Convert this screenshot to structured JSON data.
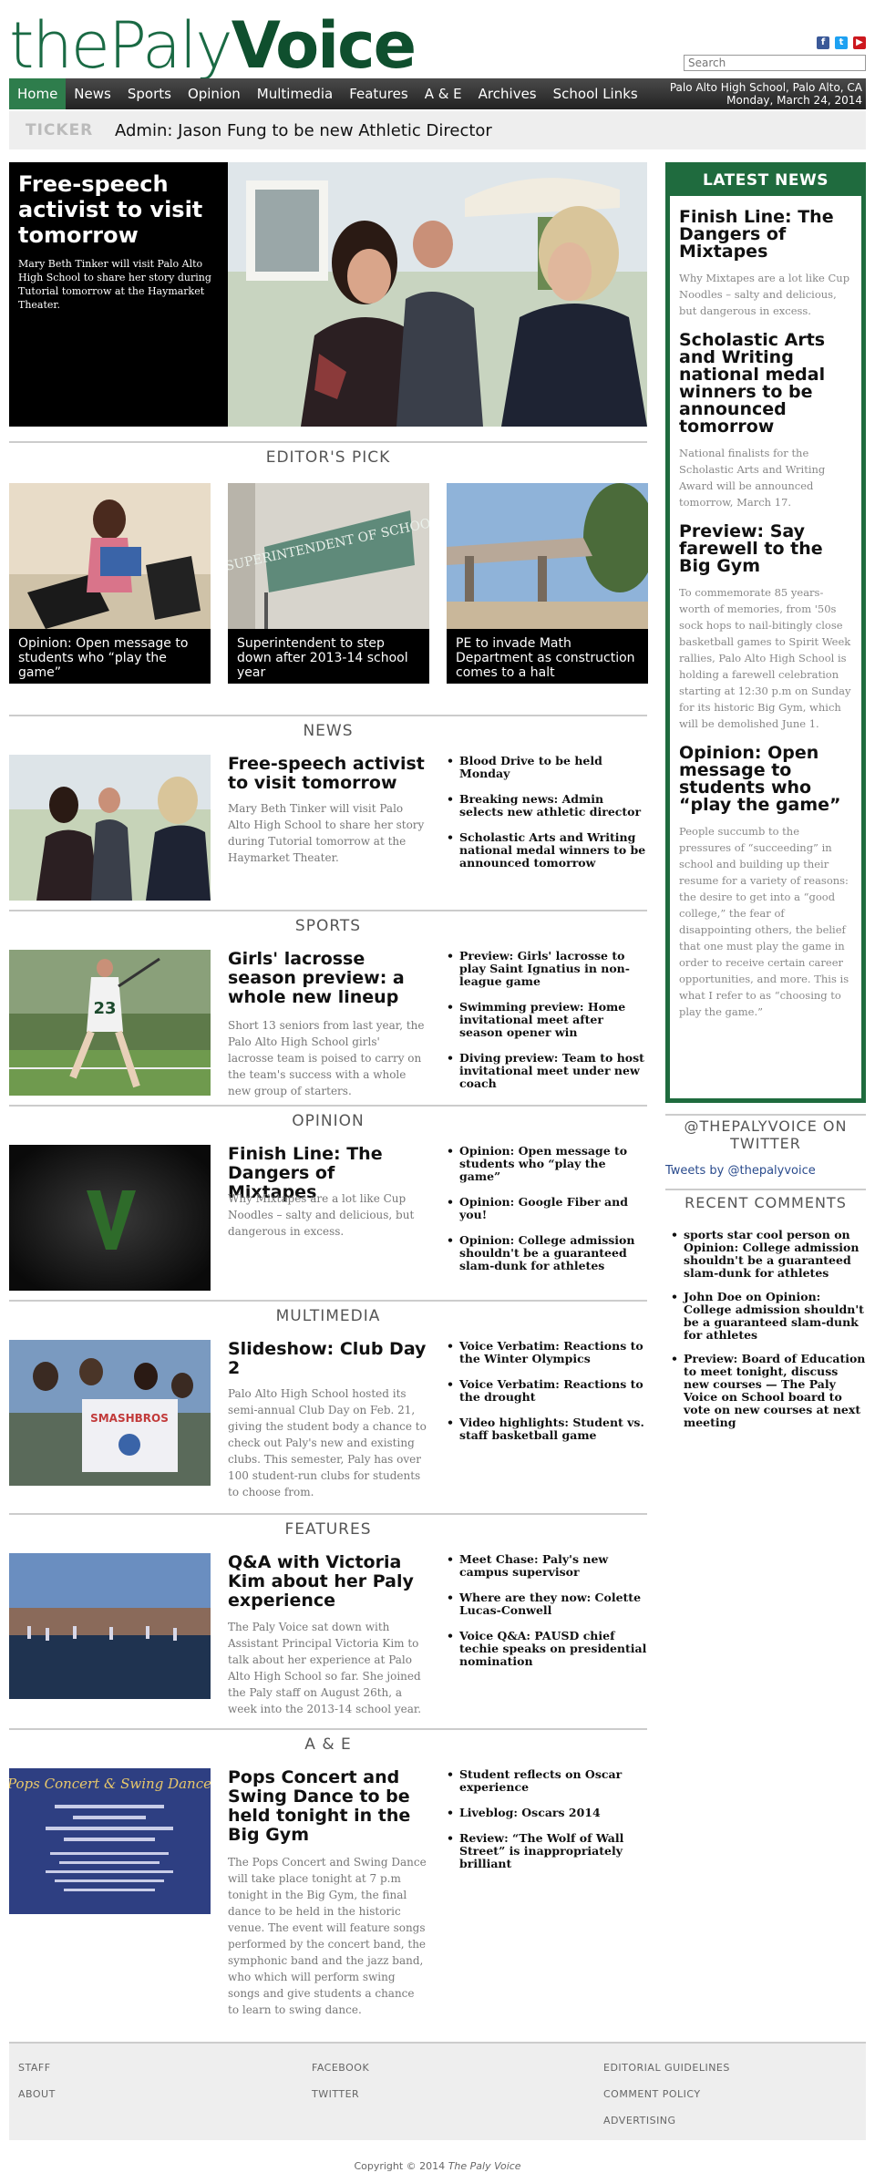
{
  "site": {
    "logo_light": "thePaly",
    "logo_bold": "Voice",
    "search_placeholder": "Search"
  },
  "social": [
    {
      "icon": "facebook-icon",
      "glyph": "f",
      "color": "#3b5998"
    },
    {
      "icon": "twitter-icon",
      "glyph": "t",
      "color": "#1da1f2"
    },
    {
      "icon": "youtube-icon",
      "glyph": "▶",
      "color": "#cc181e"
    }
  ],
  "nav": {
    "items": [
      "Home",
      "News",
      "Sports",
      "Opinion",
      "Multimedia",
      "Features",
      "A & E",
      "Archives",
      "School Links"
    ],
    "location": "Palo Alto High School, Palo Alto, CA",
    "date": "Monday, March 24, 2014"
  },
  "ticker": {
    "label": "TICKER",
    "text": "Admin: Jason Fung to be new Athletic Director"
  },
  "hero": {
    "title": "Free-speech activist to visit tomorrow",
    "summary": "Mary Beth Tinker will visit Palo Alto High School to share her story during Tutorial tomorrow at the Haymarket Theater."
  },
  "editors_pick": {
    "heading": "EDITOR'S PICK",
    "items": [
      {
        "caption": "Opinion: Open message to students who “play the game”"
      },
      {
        "caption": "Superintendent to step down after 2013-14 school year",
        "sign": "SUPERINTENDENT OF SCHOOLS"
      },
      {
        "caption": "PE to invade Math Department as construction comes to a halt"
      }
    ]
  },
  "sections": {
    "news": {
      "heading": "NEWS",
      "title": "Free-speech activist to visit tomorrow",
      "summary": "Mary Beth Tinker will visit Palo Alto High School to share her story during Tutorial tomorrow at the Haymarket Theater.",
      "links": [
        "Blood Drive to be held Monday",
        "Breaking news: Admin selects new athletic director",
        "Scholastic Arts and Writing national medal winners to be announced tomorrow"
      ]
    },
    "sports": {
      "heading": "SPORTS",
      "title": "Girls' lacrosse season preview: a whole new lineup",
      "summary": "Short 13 seniors from last year, the Palo Alto High School girls' lacrosse team is poised to carry on the team's success with a whole new group of starters.",
      "links": [
        "Preview: Girls' lacrosse to play Saint Ignatius in non-league game",
        "Swimming preview: Home invitational meet after season opener win",
        "Diving preview: Team to host invitational meet under new coach"
      ]
    },
    "opinion": {
      "heading": "OPINION",
      "title": "Finish Line: The Dangers of Mixtapes",
      "summary": "Why Mixtapes are a lot like Cup Noodles – salty and delicious, but dangerous in excess.",
      "links": [
        "Opinion: Open message to students who “play the game”",
        "Opinion: Google Fiber and you!",
        "Opinion: College admission shouldn't be a guaranteed slam-dunk for athletes"
      ]
    },
    "multimedia": {
      "heading": "MULTIMEDIA",
      "title": "Slideshow: Club Day 2",
      "summary": "Palo Alto High School hosted its semi-annual Club Day on Feb. 21, giving the student body a chance to check out Paly's new and existing clubs. This semester, Paly has over 100 student-run clubs for students to choose from.",
      "links": [
        "Voice Verbatim: Reactions to the Winter Olympics",
        "Voice Verbatim: Reactions to the drought",
        "Video highlights: Student vs. staff basketball game"
      ],
      "sign": "SMASHBROS"
    },
    "features": {
      "heading": "FEATURES",
      "title": "Q&A with Victoria Kim about her Paly experience",
      "summary": "The Paly Voice sat down with Assistant Principal Victoria Kim to talk about her experience at Palo Alto High School so far. She joined the Paly staff on August 26th, a week into the 2013-14 school year.",
      "links": [
        "Meet Chase: Paly's new campus supervisor",
        "Where are they now: Colette Lucas-Conwell",
        "Voice Q&A: PAUSD chief techie speaks on presidential nomination"
      ]
    },
    "ae": {
      "heading": "A & E",
      "title": "Pops Concert and Swing Dance to be held tonight in the Big Gym",
      "summary": "The Pops Concert and Swing Dance will take place tonight at 7 p.m tonight in the Big Gym, the final dance to be held in the historic venue. The event will feature songs performed by the concert band, the symphonic band and the jazz band, who which will perform swing songs and give students a chance to learn to swing dance.",
      "links": [
        "Student reflects on Oscar experience",
        "Liveblog: Oscars 2014",
        "Review: “The Wolf of Wall Street” is inappropriately brilliant"
      ],
      "poster_title": "Pops Concert & Swing Dance"
    }
  },
  "latest_news": {
    "heading": "LATEST NEWS",
    "items": [
      {
        "title": "Finish Line: The Dangers of Mixtapes",
        "summary": "Why Mixtapes are a lot like Cup Noodles – salty and delicious, but dangerous in excess."
      },
      {
        "title": "Scholastic Arts and Writing national medal winners to be announced tomorrow",
        "summary": "National finalists for the Scholastic Arts and Writing Award will be announced tomorrow, March 17."
      },
      {
        "title": "Preview: Say farewell to the Big Gym",
        "summary": "To commemorate 85 years-worth of memories, from '50s sock hops to nail-bitingly close basketball games to Spirit Week rallies, Palo Alto High School is holding a farewell celebration starting at 12:30 p.m on Sunday for its historic Big Gym, which will be demolished June 1."
      },
      {
        "title": "Opinion: Open message to students who “play the game”",
        "summary": "People succumb to the pressures of “succeeding” in school and building up their resume for a variety of reasons: the desire to get into a “good college,” the fear of disappointing others, the belief that one must play the game in order to receive certain career opportunities, and more. This is what I refer to as “choosing to play the game.”"
      }
    ]
  },
  "twitter": {
    "heading": "@THEPALYVOICE ON TWITTER",
    "link": "Tweets by @thepalyvoice"
  },
  "recent_comments": {
    "heading": "RECENT COMMENTS",
    "items": [
      "sports star cool person on Opinion: College admission shouldn't be a guaranteed slam-dunk for athletes",
      "John Doe on Opinion: College admission shouldn't be a guaranteed slam-dunk for athletes",
      "Preview: Board of Education to meet tonight, discuss new courses — The Paly Voice on School board to vote on new courses at next meeting"
    ]
  },
  "footer": {
    "col1": [
      "STAFF",
      "ABOUT"
    ],
    "col2": [
      "FACEBOOK",
      "TWITTER"
    ],
    "col3": [
      "EDITORIAL GUIDELINES",
      "COMMENT POLICY",
      "ADVERTISING"
    ],
    "copyright_prefix": "Copyright © 2014",
    "copyright_name": "The Paly Voice"
  }
}
